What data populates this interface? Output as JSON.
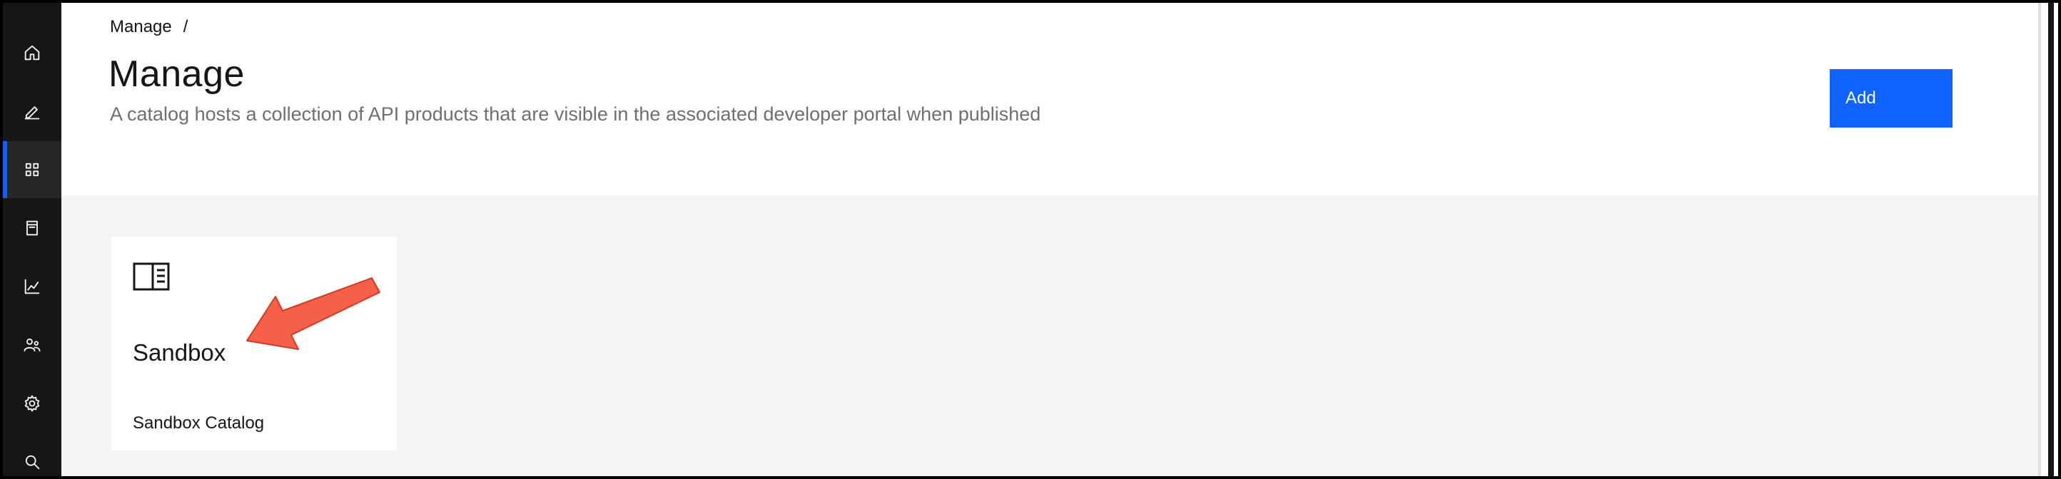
{
  "nav": {
    "items": [
      {
        "icon": "home-icon",
        "active": false
      },
      {
        "icon": "edit-icon",
        "active": false
      },
      {
        "icon": "grid-icon",
        "active": true
      },
      {
        "icon": "catalog-icon",
        "active": false
      },
      {
        "icon": "analytics-icon",
        "active": false
      },
      {
        "icon": "users-icon",
        "active": false
      },
      {
        "icon": "settings-icon",
        "active": false
      },
      {
        "icon": "search-icon",
        "active": false
      }
    ]
  },
  "breadcrumb": {
    "item": "Manage",
    "separator": "/"
  },
  "header": {
    "title": "Manage",
    "description": "A catalog hosts a collection of API products that are visible in the associated developer portal when published",
    "add_label": "Add"
  },
  "catalogs": [
    {
      "icon": "catalog-panel-icon",
      "name": "Sandbox",
      "subtitle": "Sandbox Catalog"
    }
  ],
  "colors": {
    "accent": "#0f62fe",
    "nav_background": "#161616",
    "annotation_arrow": "#f4604a"
  }
}
